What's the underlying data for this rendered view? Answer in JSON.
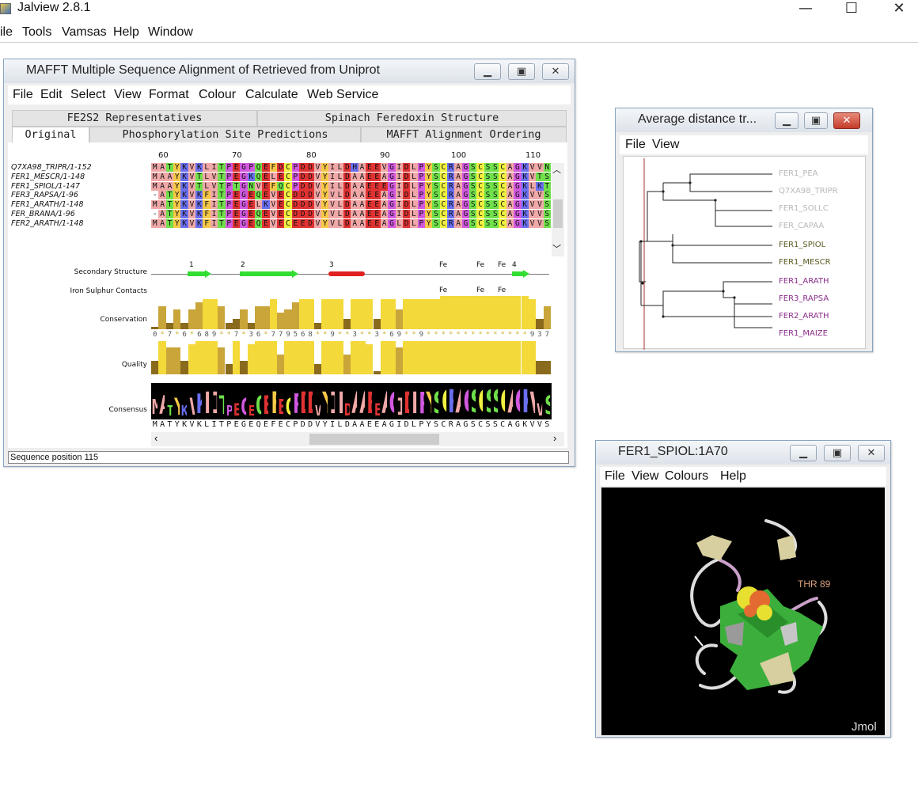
{
  "app": {
    "title": "Jalview 2.8.1",
    "controls": {
      "minimize": "—",
      "maximize": "☐",
      "close": "✕"
    },
    "menu": [
      "ile",
      "Tools",
      "Vamsas",
      "Help",
      "Window"
    ]
  },
  "alignment_window": {
    "title": "MAFFT Multiple Sequence Alignment of Retrieved from Uniprot",
    "menu": [
      "File",
      "Edit",
      "Select",
      "View",
      "Format",
      "Colour",
      "Calculate",
      "Web Service"
    ],
    "tabs_row1": [
      "FE2S2 Representatives",
      "Spinach Feredoxin Structure"
    ],
    "tabs_row2": [
      "Original",
      "Phosphorylation Site Predictions",
      "MAFFT Alignment Ordering"
    ],
    "selected_tab": "Original",
    "ruler": [
      "60",
      "70",
      "80",
      "90",
      "100",
      "110"
    ],
    "sequences": [
      {
        "name": "Q7XA98_TRIPR/1-152",
        "residues": "MATYKVKLITPEGPQEFDCPDDVYILDHAEEVGIDLPYSCRAGSCSSCAGKVVN"
      },
      {
        "name": "FER1_MESCR/1-148",
        "residues": "MAAYKVTLVTPEGKQELECPDDVYILDAAEEAGIDLPYSCRAGSCSSCAGKVTS"
      },
      {
        "name": "FER1_SPIOL/1-147",
        "residues": "MAAYKVTLVTPTGNVEFQCPDDVYILDAAEEEGIDLPYSCRAGSCSSCAGKLKT"
      },
      {
        "name": "FER3_RAPSA/1-96",
        "residues": "-ATYKVKFITPEGEQEVECDDDVYVLDAAEEAGIDLPYSCRAGSCSSCAGKVVS"
      },
      {
        "name": "FER1_ARATH/1-148",
        "residues": "MATYKVKFITPEGELKVECDDDVYVLDAAEEAGIDLPYSCRAGSCSSCAGKVVS"
      },
      {
        "name": "FER_BRANA/1-96",
        "residues": "-ATYKVKFITPEGEQEVECDDDVYVLDAAEEAGIDLPYSCRAGSCSSCAGKVVS"
      },
      {
        "name": "FER2_ARATH/1-148",
        "residues": "MATYKVKFITPEGEQEVECEEDVYVLDAAEEAGLDLPYSCRAGSCSSCAGKVVS"
      }
    ],
    "annotations": {
      "secondary_structure_label": "Secondary Structure",
      "ss_markers": [
        "1",
        "2",
        "3",
        "Fe",
        "Fe",
        "Fe",
        "4"
      ],
      "iron_label": "Iron Sulphur Contacts",
      "iron_markers": [
        "Fe",
        "Fe",
        "Fe"
      ],
      "conservation_label": "Conservation",
      "conservation_digits": "0*7*6*689**7*36*779568**9**3**3*69**9**************937",
      "conservation": [
        0.0,
        0.7,
        0.2,
        0.6,
        0.2,
        0.6,
        0.8,
        0.9,
        0.9,
        0.7,
        0.2,
        0.3,
        0.6,
        0.2,
        0.7,
        0.7,
        0.9,
        0.5,
        0.6,
        0.8,
        0.9,
        0.9,
        0.2,
        0.9,
        0.9,
        0.9,
        0.3,
        0.9,
        0.9,
        0.9,
        0.3,
        0.9,
        0.9,
        0.6,
        0.9,
        0.9,
        0.9,
        0.9,
        0.9,
        1.0,
        1.0,
        1.0,
        1.0,
        1.0,
        1.0,
        1.0,
        1.0,
        1.0,
        1.0,
        1.0,
        1.0,
        0.9,
        0.3,
        0.7
      ],
      "quality_label": "Quality",
      "quality": [
        0.4,
        1.0,
        0.8,
        0.8,
        0.4,
        0.9,
        1.0,
        1.0,
        1.0,
        0.8,
        0.3,
        1.0,
        0.4,
        0.9,
        1.0,
        1.0,
        1.0,
        0.6,
        1.0,
        1.0,
        1.0,
        1.0,
        0.3,
        1.0,
        1.0,
        1.0,
        0.6,
        1.0,
        1.0,
        0.9,
        0.1,
        1.0,
        1.0,
        0.8,
        1.0,
        1.0,
        1.0,
        1.0,
        1.0,
        1.0,
        1.0,
        1.0,
        1.0,
        1.0,
        1.0,
        1.0,
        1.0,
        1.0,
        1.0,
        1.0,
        1.0,
        1.0,
        0.4,
        0.4
      ],
      "consensus_label": "Consensus",
      "consensus_sequence": "MATYKVKLITPEGEQEFECPDDVYILDAAEEAGIDLPYSCRAGSCSSCAGKVVS"
    },
    "status": "Sequence position 115"
  },
  "tree_window": {
    "title": "Average distance tr...",
    "menu": [
      "File",
      "View"
    ],
    "leaves": [
      {
        "name": "FER1_PEA",
        "color": "#b8b8b8"
      },
      {
        "name": "Q7XA98_TRIPR",
        "color": "#b8b8b8"
      },
      {
        "name": "FER1_SOLLC",
        "color": "#b8b8b8"
      },
      {
        "name": "FER_CAPAA",
        "color": "#b8b8b8"
      },
      {
        "name": "FER1_SPIOL",
        "color": "#5b5a22"
      },
      {
        "name": "FER1_MESCR",
        "color": "#5b5a22"
      },
      {
        "name": "FER1_ARATH",
        "color": "#8a2d8a"
      },
      {
        "name": "FER3_RAPSA",
        "color": "#8a2d8a"
      },
      {
        "name": "FER2_ARATH",
        "color": "#8a2d8a"
      },
      {
        "name": "FER1_MAIZE",
        "color": "#8a2d8a"
      }
    ]
  },
  "jmol_window": {
    "title": "FER1_SPIOL:1A70",
    "menu": [
      "File",
      "View",
      "Colours",
      "Help"
    ],
    "residue_label": "THR 89",
    "watermark": "Jmol"
  },
  "colors": {
    "frame_border": "#8aa4c0",
    "conservation_yellow": "#f3d93a",
    "conservation_brown": "#8a6a1c",
    "ss_helix": "#e02020",
    "ss_strand": "#33dd33"
  }
}
